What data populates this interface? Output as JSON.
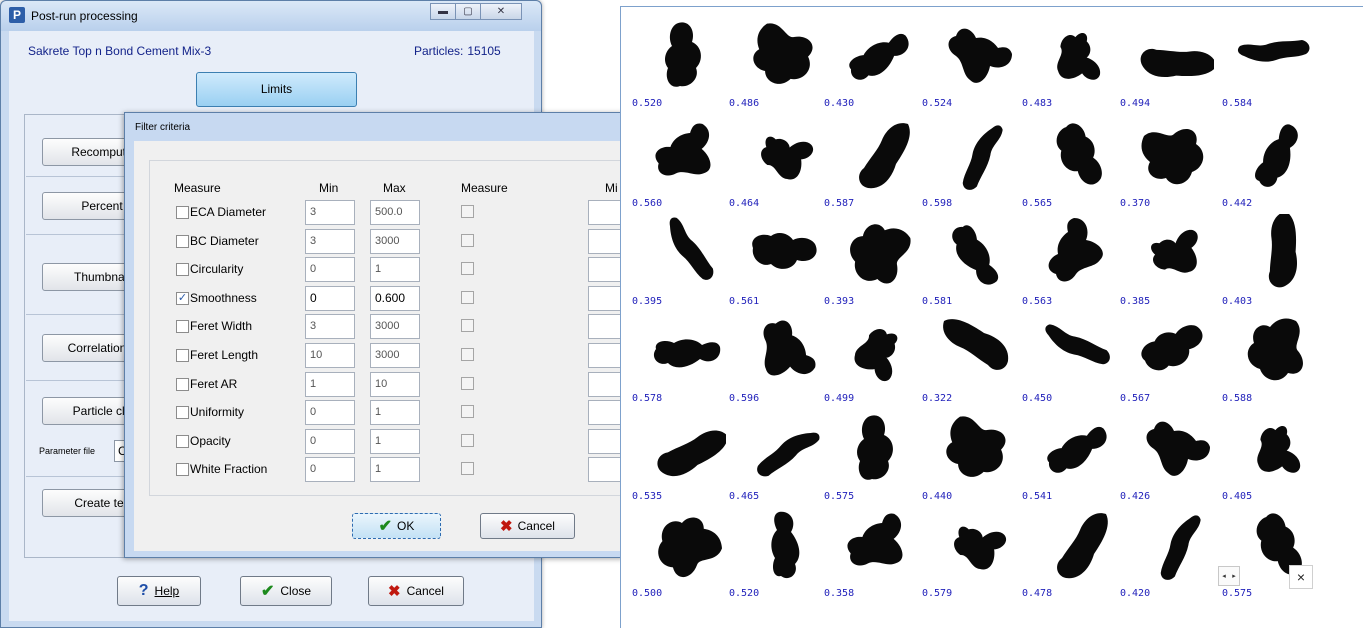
{
  "main_window": {
    "title": "Post-run processing",
    "app_icon": "P",
    "mix_name": "Sakrete Top n Bond Cement Mix-3",
    "particles_label": "Particles:",
    "particles_count": "15105",
    "limits_label": "Limits",
    "side_buttons": [
      "Recompute",
      "Percent",
      "Thumbnail",
      "Correlation p",
      "Particle cla",
      "Create tex"
    ],
    "parameter_file_label": "Parameter file",
    "parameter_file_value": "C",
    "help_label": "Help",
    "close_label": "Close",
    "cancel_label": "Cancel",
    "icons": {
      "help": "help-icon",
      "close": "check-icon",
      "cancel": "x-icon"
    }
  },
  "filter_dialog": {
    "title": "Filter criteria",
    "headers": {
      "measure": "Measure",
      "min": "Min",
      "max": "Max",
      "measure2": "Measure",
      "min2": "Mi"
    },
    "rows": [
      {
        "name": "ECA Diameter",
        "checked": false,
        "min": "3",
        "max": "500.0"
      },
      {
        "name": "BC Diameter",
        "checked": false,
        "min": "3",
        "max": "3000"
      },
      {
        "name": "Circularity",
        "checked": false,
        "min": "0",
        "max": "1"
      },
      {
        "name": "Smoothness",
        "checked": true,
        "min": "0",
        "max": "0.600"
      },
      {
        "name": "Feret Width",
        "checked": false,
        "min": "3",
        "max": "3000"
      },
      {
        "name": "Feret Length",
        "checked": false,
        "min": "10",
        "max": "3000"
      },
      {
        "name": "Feret AR",
        "checked": false,
        "min": "1",
        "max": "10"
      },
      {
        "name": "Uniformity",
        "checked": false,
        "min": "0",
        "max": "1"
      },
      {
        "name": "Opacity",
        "checked": false,
        "min": "0",
        "max": "1"
      },
      {
        "name": "White Fraction",
        "checked": false,
        "min": "0",
        "max": "1"
      }
    ],
    "ok_label": "OK",
    "cancel_label": "Cancel"
  },
  "thumbnails": {
    "values": [
      [
        "0.520",
        "0.486",
        "0.430",
        "0.524",
        "0.483",
        "0.494",
        "0.584"
      ],
      [
        "0.560",
        "0.464",
        "0.587",
        "0.598",
        "0.565",
        "0.370",
        "0.442"
      ],
      [
        "0.395",
        "0.561",
        "0.393",
        "0.581",
        "0.563",
        "0.385",
        "0.403"
      ],
      [
        "0.578",
        "0.596",
        "0.499",
        "0.322",
        "0.450",
        "0.567",
        "0.588"
      ],
      [
        "0.535",
        "0.465",
        "0.575",
        "0.440",
        "0.541",
        "0.426",
        "0.405"
      ],
      [
        "0.500",
        "0.520",
        "0.358",
        "0.579",
        "0.478",
        "0.420",
        "0.575"
      ]
    ],
    "nav_prev": "◂",
    "nav_next": "▸",
    "close": "×"
  }
}
